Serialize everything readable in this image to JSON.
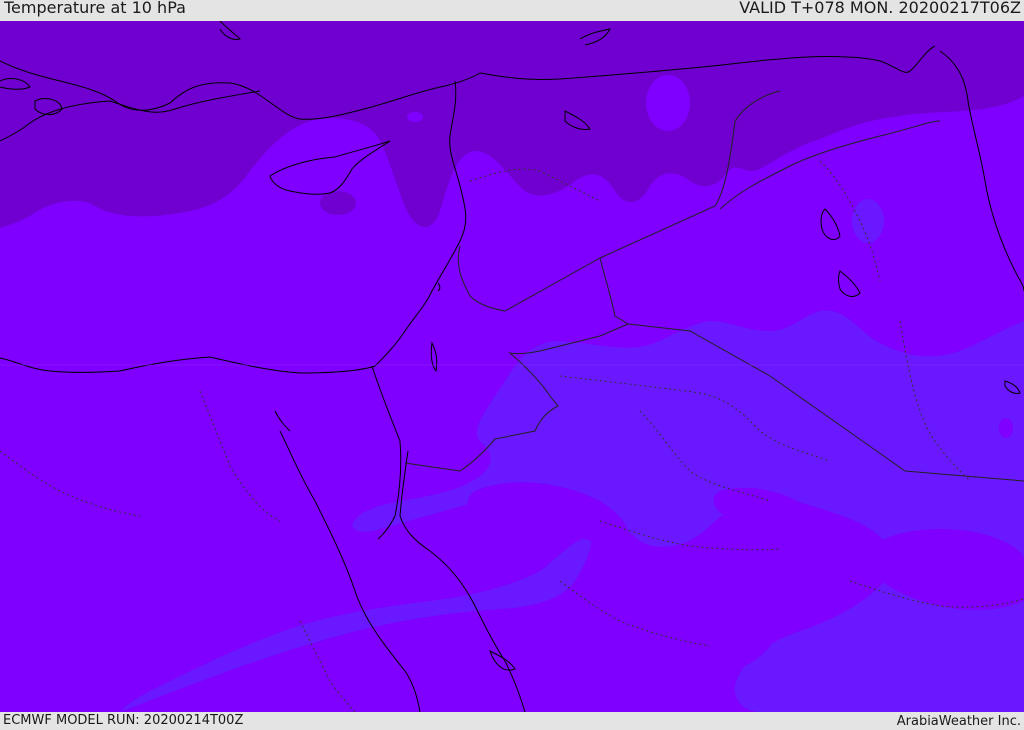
{
  "header": {
    "title": "Temperature at 10 hPa",
    "valid": "VALID T+078 MON. 20200217T06Z"
  },
  "footer": {
    "model_run": "ECMWF MODEL RUN: 20200214T00Z",
    "credit": "ArabiaWeather Inc."
  },
  "map": {
    "region": "Eastern Mediterranean / Middle East",
    "field": "Temperature at 10 hPa",
    "colors": {
      "cold_band": "#7000d0",
      "base": "#7f00ff",
      "warm_band": "#6a18ff",
      "coastline": "#000000",
      "border": "#333333"
    }
  }
}
